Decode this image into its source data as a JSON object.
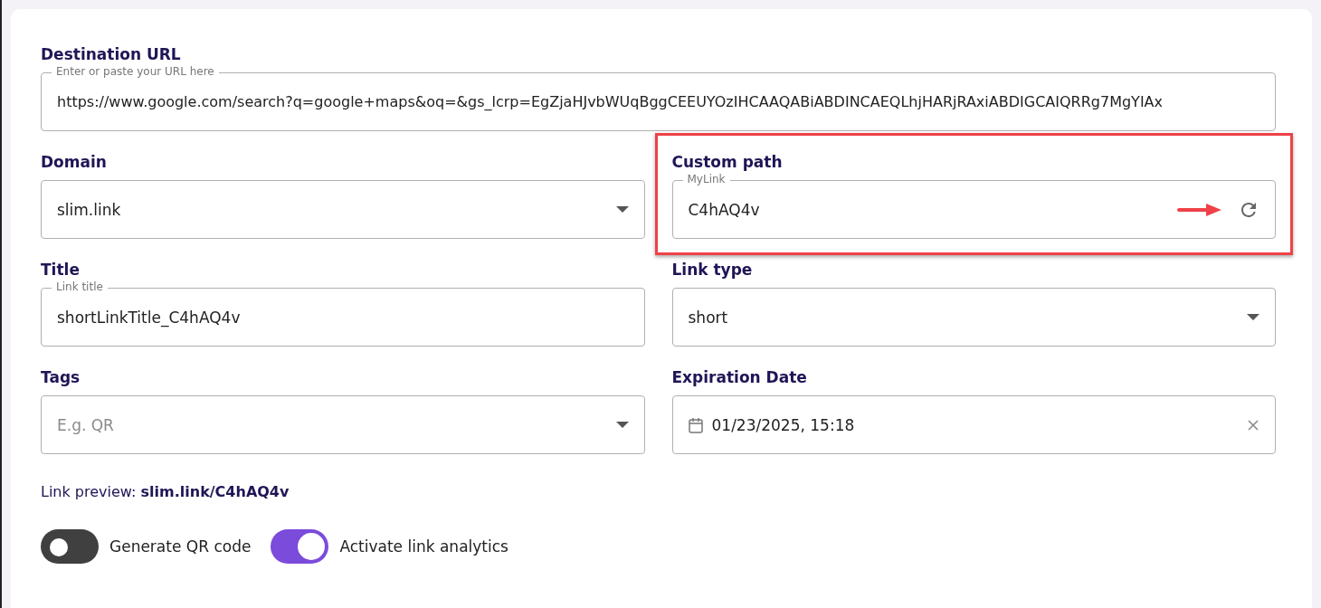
{
  "destination_url": {
    "label": "Destination URL",
    "placeholder": "Enter or paste your URL here",
    "value": "https://www.google.com/search?q=google+maps&oq=&gs_lcrp=EgZjaHJvbWUqBggCEEUYOzIHCAAQABiABDINCAEQLhjHARjRAxiABDIGCAIQRRg7MgYIAx"
  },
  "fields": [
    {
      "kind": "select",
      "label": "Domain",
      "value": "slim.link",
      "highlighted": false
    },
    {
      "kind": "text",
      "label": "Custom path",
      "placeholder": "MyLink",
      "value": "C4hAQ4v",
      "refresh": true,
      "highlighted": true
    },
    {
      "kind": "text",
      "label": "Title",
      "placeholder": "Link title",
      "value": "shortLinkTitle_C4hAQ4v",
      "refresh": false,
      "highlighted": false
    },
    {
      "kind": "select",
      "label": "Link type",
      "value": "short",
      "highlighted": false
    },
    {
      "kind": "select",
      "label": "Tags",
      "placeholder": "E.g. QR",
      "highlighted": false
    },
    {
      "kind": "date",
      "label": "Expiration Date",
      "value": "01/23/2025, 15:18",
      "highlighted": false
    }
  ],
  "preview": {
    "label": "Link preview:",
    "value": "slim.link/C4hAQ4v"
  },
  "toggles": [
    {
      "label": "Generate QR code",
      "on": false
    },
    {
      "label": "Activate link analytics",
      "on": true
    }
  ]
}
